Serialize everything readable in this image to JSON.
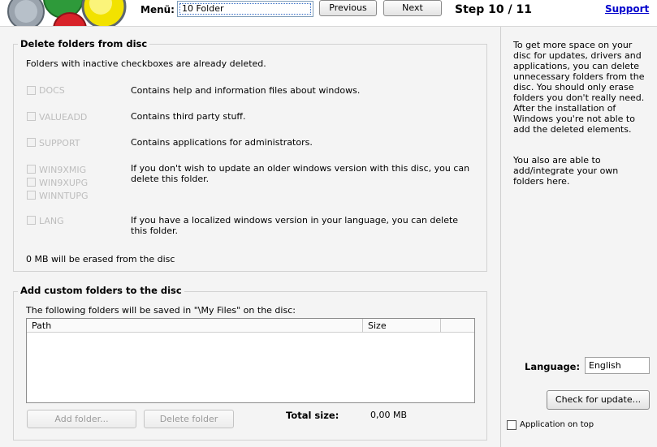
{
  "header": {
    "menu_label": "Menü:",
    "menu_selected": "10 Folder",
    "previous_label": "Previous",
    "next_label": "Next",
    "step_text": "Step 10 / 11",
    "support_label": "Support"
  },
  "delete_group": {
    "title": "Delete folders from disc",
    "note": "Folders with inactive checkboxes are already deleted.",
    "folders": [
      {
        "names": [
          "DOCS"
        ],
        "desc": "Contains help and information files about windows."
      },
      {
        "names": [
          "VALUEADD"
        ],
        "desc": "Contains third party stuff."
      },
      {
        "names": [
          "SUPPORT"
        ],
        "desc": "Contains applications for administrators."
      },
      {
        "names": [
          "WIN9XMIG",
          "WIN9XUPG",
          "WINNTUPG"
        ],
        "desc": "If you don't wish to update an older windows version with this disc, you can delete this folder."
      },
      {
        "names": [
          "LANG"
        ],
        "desc": "If you have a localized windows version in your language, you can delete this folder."
      }
    ],
    "erase_summary": "0 MB will be erased from the disc"
  },
  "custom_group": {
    "title": "Add custom folders to the disc",
    "note": "The following folders will be saved in \"\\My Files\" on the disc:",
    "columns": [
      "Path",
      "Size"
    ],
    "add_label": "Add folder...",
    "delete_label": "Delete folder",
    "total_label": "Total size:",
    "total_value": "0,00 MB"
  },
  "side": {
    "para1": "To get more space on your disc for updates, drivers and applications, you can delete unnecessary folders from the disc. You should only erase folders you don't really need. After the installation of Windows you're not able to add the deleted elements.",
    "para2": "You also are able to add/integrate your own folders here.",
    "language_label": "Language:",
    "language_value": "English",
    "check_update_label": "Check for update...",
    "app_on_top_label": "Application on top"
  }
}
